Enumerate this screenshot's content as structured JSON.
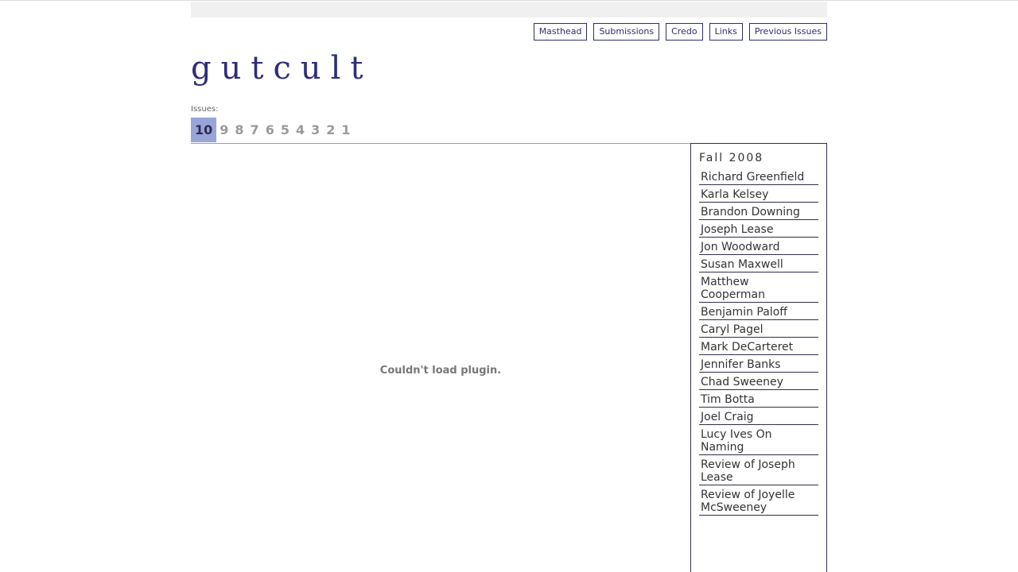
{
  "nav": {
    "items": [
      "Masthead",
      "Submissions",
      "Credo",
      "Links",
      "Previous Issues"
    ]
  },
  "site": {
    "title": "gutcult"
  },
  "issues": {
    "label": "Issues:",
    "numbers": [
      "10",
      "9",
      "8",
      "7",
      "6",
      "5",
      "4",
      "3",
      "2",
      "1"
    ],
    "active": "10"
  },
  "plugin": {
    "message": "Couldn't load plugin."
  },
  "sidebar": {
    "season": "Fall 2008",
    "items": [
      "Richard Greenfield",
      "Karla Kelsey",
      "Brandon Downing",
      "Joseph Lease",
      "Jon Woodward",
      "Susan Maxwell",
      "Matthew Cooperman",
      "Benjamin Paloff",
      "Caryl Pagel",
      "Mark DeCarteret",
      "Jennifer Banks",
      "Chad Sweeney",
      "Tim Botta",
      "Joel Craig",
      "Lucy Ives On Naming",
      "Review of Joseph Lease",
      "Review of Joyelle McSweeney"
    ]
  },
  "colors": {
    "accent": "#2e2e7a",
    "active_issue_bg": "#99a4d9"
  }
}
